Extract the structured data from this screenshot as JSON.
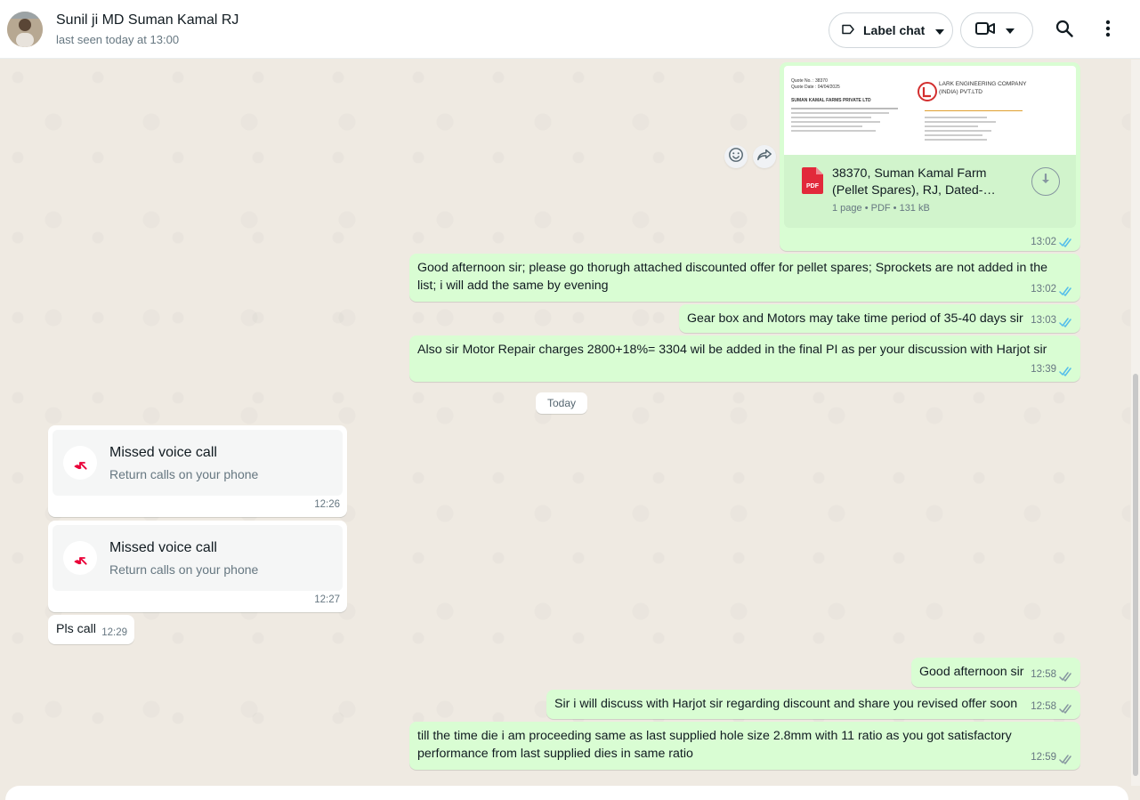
{
  "header": {
    "contact_name": "Sunil ji MD Suman Kamal RJ",
    "last_seen": "last seen today at 13:00",
    "label_chat": "Label chat"
  },
  "icons": {
    "label": "label-icon",
    "video": "video-camera-icon",
    "search": "search-icon",
    "menu": "kebab-menu-icon",
    "pdf": "pdf-file-icon",
    "download": "download-icon",
    "missed_call": "missed-call-icon",
    "read_receipt": "double-check-icon"
  },
  "colors": {
    "outgoing_bubble": "#d9fdd3",
    "incoming_bubble": "#ffffff",
    "read_tick": "#53bdeb",
    "missed_call_red": "#ea0038",
    "pdf_red": "#e2293b"
  },
  "pdf": {
    "name_line1": "38370, Suman Kamal Farm",
    "name_line2": "(Pellet Spares), RJ, Dated-…",
    "info": "1 page • PDF • 131 kB",
    "time": "13:02",
    "preview": {
      "quote_no": "Quote No. : 38370",
      "quote_date": "Quote Date : 04/04/2025",
      "company": "LARK ENGINEERING COMPANY (INDIA) PVT.LTD",
      "customer": "SUMAN KAMAL FARMS PRIVATE LTD"
    }
  },
  "messages_out_1": [
    {
      "text": "Good afternoon sir; please go thorugh attached discounted offer for pellet spares; Sprockets are not added in the list; i will add the same by evening",
      "time": "13:02"
    },
    {
      "text": "Gear box and Motors may take time period of 35-40 days sir",
      "time": "13:03"
    },
    {
      "text": "Also sir Motor Repair charges 2800+18%= 3304 wil be added in the final PI as per your discussion with Harjot sir",
      "time": "13:39"
    }
  ],
  "date_divider": "Today",
  "calls": [
    {
      "title": "Missed voice call",
      "subtitle": "Return calls on your phone",
      "time": "12:26"
    },
    {
      "title": "Missed voice call",
      "subtitle": "Return calls on your phone",
      "time": "12:27"
    }
  ],
  "incoming_text": {
    "text": "Pls call",
    "time": "12:29"
  },
  "messages_out_2": [
    {
      "text": "Good afternoon sir",
      "time": "12:58"
    },
    {
      "text": "Sir i will discuss with Harjot sir regarding discount and share you revised offer soon",
      "time": "12:58"
    },
    {
      "text": "till the time die i am proceeding same as last supplied hole size 2.8mm with 11 ratio as you got satisfactory performance from last supplied dies in same ratio",
      "time": "12:59"
    }
  ]
}
